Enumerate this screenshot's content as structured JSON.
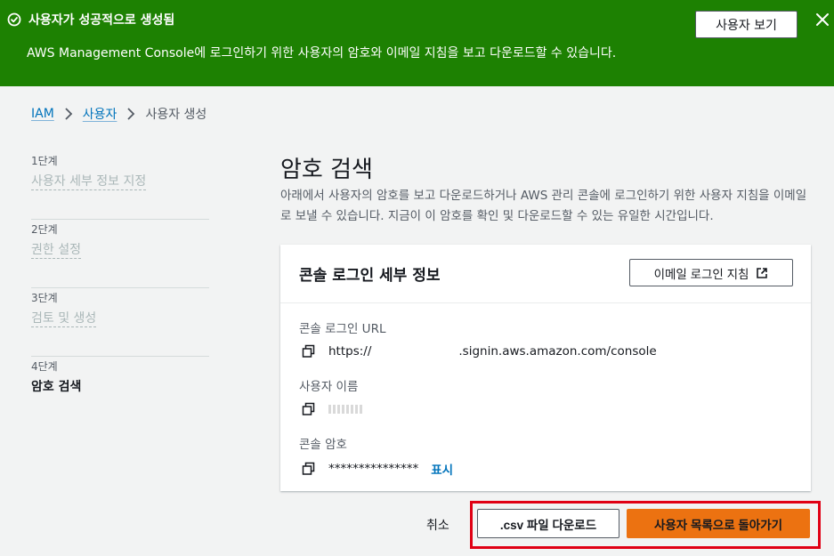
{
  "banner": {
    "title": "사용자가 성공적으로 생성됨",
    "message": "AWS Management Console에 로그인하기 위한 사용자의 암호와 이메일 지침을 보고 다운로드할 수 있습니다.",
    "view_user_label": "사용자 보기",
    "color": "#1d8102"
  },
  "breadcrumb": {
    "items": [
      "IAM",
      "사용자",
      "사용자 생성"
    ]
  },
  "steps": [
    {
      "num": "1단계",
      "label": "사용자 세부 정보 지정"
    },
    {
      "num": "2단계",
      "label": "권한 설정"
    },
    {
      "num": "3단계",
      "label": "검토 및 생성"
    },
    {
      "num": "4단계",
      "label": "암호 검색"
    }
  ],
  "main": {
    "title": "암호 검색",
    "description": "아래에서 사용자의 암호를 보고 다운로드하거나 AWS 관리 콘솔에 로그인하기 위한 사용자 지침을 이메일로 보낼 수 있습니다. 지금이 이 암호를 확인 및 다운로드할 수 있는 유일한 시간입니다."
  },
  "card": {
    "title": "콘솔 로그인 세부 정보",
    "email_button": "이메일 로그인 지침",
    "fields": {
      "url_label": "콘솔 로그인 URL",
      "url_prefix": "https://",
      "url_suffix": ".signin.aws.amazon.com/console",
      "username_label": "사용자 이름",
      "password_label": "콘솔 암호",
      "password_value": "***************",
      "show_label": "표시"
    }
  },
  "actions": {
    "cancel": "취소",
    "csv_download": ".csv 파일 다운로드",
    "back_to_list": "사용자 목록으로 돌아가기",
    "primary_color": "#ec7211",
    "highlight_color": "#e00014"
  }
}
